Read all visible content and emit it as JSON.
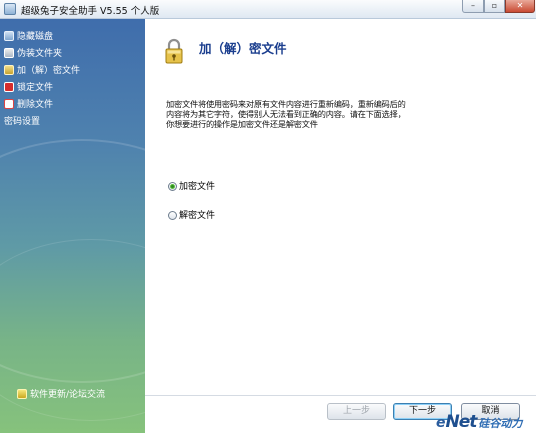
{
  "window": {
    "title": "超级兔子安全助手 V5.55 个人版",
    "controls": {
      "minimize": "–",
      "maximize": "▫",
      "close": "✕"
    }
  },
  "sidebar": {
    "items": [
      {
        "label": "隐藏磁盘",
        "icon": "hidden-disk-icon"
      },
      {
        "label": "伪装文件夹",
        "icon": "disguise-folder-icon"
      },
      {
        "label": "加（解）密文件",
        "icon": "encrypt-file-icon"
      },
      {
        "label": "锁定文件",
        "icon": "lock-file-icon"
      },
      {
        "label": "删除文件",
        "icon": "delete-file-icon"
      },
      {
        "label": "密码设置",
        "icon": ""
      }
    ],
    "footer_link": "软件更新/论坛交流"
  },
  "main": {
    "title": "加（解）密文件",
    "description": "加密文件将使用密码来对原有文件内容进行重新编码，重新编码后的内容将为其它字符，使得别人无法看到正确的内容。请在下面选择，你想要进行的操作是加密文件还是解密文件",
    "options": [
      {
        "label": "加密文件",
        "selected": true
      },
      {
        "label": "解密文件",
        "selected": false
      }
    ]
  },
  "buttons": {
    "prev": "上一步",
    "next": "下一步",
    "cancel": "取消"
  },
  "watermark": {
    "e": "e",
    "net": "Net",
    "cn": "硅谷动力"
  },
  "colors": {
    "sidebar_top": "#3f6dac",
    "sidebar_bottom": "#86c27c",
    "title_blue": "#1b3e8e"
  }
}
